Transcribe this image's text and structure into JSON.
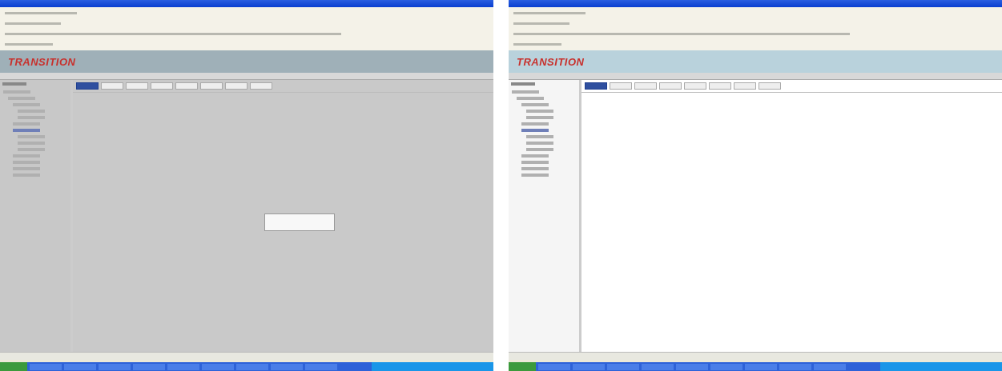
{
  "windows": [
    {
      "logo": "TRANSITION",
      "dimmed": true,
      "dialog": true,
      "tabs": [
        {
          "selected": true
        },
        {
          "selected": false
        },
        {
          "selected": false
        },
        {
          "selected": false
        },
        {
          "selected": false
        },
        {
          "selected": false
        },
        {
          "selected": false
        },
        {
          "selected": false
        }
      ],
      "tree": [
        {
          "selected": false,
          "children": [
            {
              "selected": false,
              "children": [
                {
                  "selected": false,
                  "children": [
                    {
                      "selected": false
                    },
                    {
                      "selected": false
                    }
                  ]
                },
                {
                  "selected": false
                },
                {
                  "selected": true,
                  "children": [
                    {
                      "selected": false
                    },
                    {
                      "selected": false
                    },
                    {
                      "selected": false
                    }
                  ]
                },
                {
                  "selected": false
                },
                {
                  "selected": false
                },
                {
                  "selected": false
                },
                {
                  "selected": false
                }
              ]
            }
          ]
        }
      ]
    },
    {
      "logo": "TRANSITION",
      "dimmed": false,
      "dialog": false,
      "tabs": [
        {
          "selected": true
        },
        {
          "selected": false
        },
        {
          "selected": false
        },
        {
          "selected": false
        },
        {
          "selected": false
        },
        {
          "selected": false
        },
        {
          "selected": false
        },
        {
          "selected": false
        }
      ],
      "tree": [
        {
          "selected": false,
          "children": [
            {
              "selected": false,
              "children": [
                {
                  "selected": false,
                  "children": [
                    {
                      "selected": false
                    },
                    {
                      "selected": false
                    }
                  ]
                },
                {
                  "selected": false
                },
                {
                  "selected": true,
                  "children": [
                    {
                      "selected": false
                    },
                    {
                      "selected": false
                    },
                    {
                      "selected": false
                    }
                  ]
                },
                {
                  "selected": false
                },
                {
                  "selected": false
                },
                {
                  "selected": false
                },
                {
                  "selected": false
                }
              ]
            }
          ]
        }
      ]
    }
  ]
}
